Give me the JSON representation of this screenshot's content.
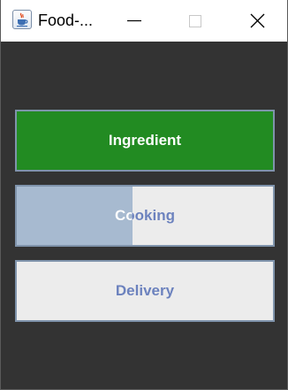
{
  "window": {
    "title": "Food-...",
    "icon": "java-cup-icon",
    "controls": [
      "minimize-icon",
      "maximize-icon",
      "close-icon"
    ]
  },
  "stages": [
    {
      "label": "Ingredient",
      "state": "complete",
      "progress": 1.0,
      "color": "#228b22"
    },
    {
      "label": "Cooking",
      "state": "in-progress",
      "progress": 0.45,
      "color": "#a7bad0"
    },
    {
      "label": "Delivery",
      "state": "pending",
      "progress": 0.0,
      "color": "#ececec"
    }
  ],
  "colors": {
    "background": "#333333",
    "label": "#6c82be",
    "border": "#7f93ab"
  }
}
